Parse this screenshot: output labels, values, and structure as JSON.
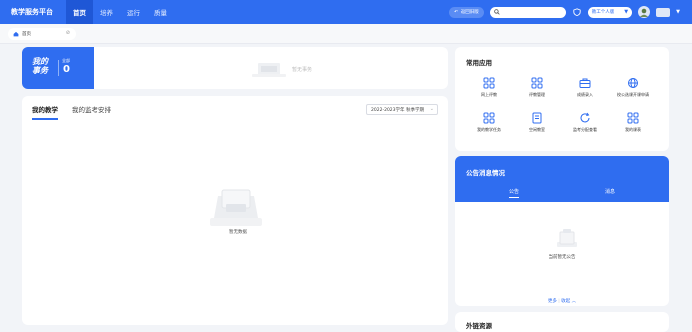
{
  "header": {
    "brand": "教学服务平台",
    "nav": [
      "首页",
      "培养",
      "运行",
      "质量"
    ],
    "return_label": "返回旧版",
    "search_placeholder": "",
    "role_label": "教工个人版"
  },
  "tabs": [
    {
      "label": "首页"
    }
  ],
  "todo": {
    "title_line1": "我的",
    "title_line2": "事务",
    "count_label": "全部",
    "count": "0",
    "empty_text": "暂无事务"
  },
  "teaching": {
    "tabs": [
      "我的教学",
      "我的监考安排"
    ],
    "term_select": "2022-2023学年 秋季学期",
    "empty_text": "暂无数据"
  },
  "apps": {
    "title": "常用应用",
    "items": [
      {
        "label": "网上评教",
        "icon": "grid-icon"
      },
      {
        "label": "评教管理",
        "icon": "grid-icon"
      },
      {
        "label": "成绩录入",
        "icon": "briefcase-icon"
      },
      {
        "label": "校公选课开课申请",
        "icon": "globe-icon"
      },
      {
        "label": "我的教学任务",
        "icon": "grid-icon"
      },
      {
        "label": "空闲教室",
        "icon": "document-icon"
      },
      {
        "label": "监考分配查看",
        "icon": "refresh-icon"
      },
      {
        "label": "我的课表",
        "icon": "grid-icon"
      }
    ]
  },
  "notice": {
    "title": "公告消息情况",
    "tabs": [
      "公告",
      "消息"
    ],
    "empty_text": "当前暂无公告",
    "more_label": "更多",
    "collapse_label": "收起 ︿"
  },
  "bottom_card": {
    "title": "外链资源"
  },
  "colors": {
    "primary": "#2f6df0",
    "background": "#f2f4f8"
  }
}
